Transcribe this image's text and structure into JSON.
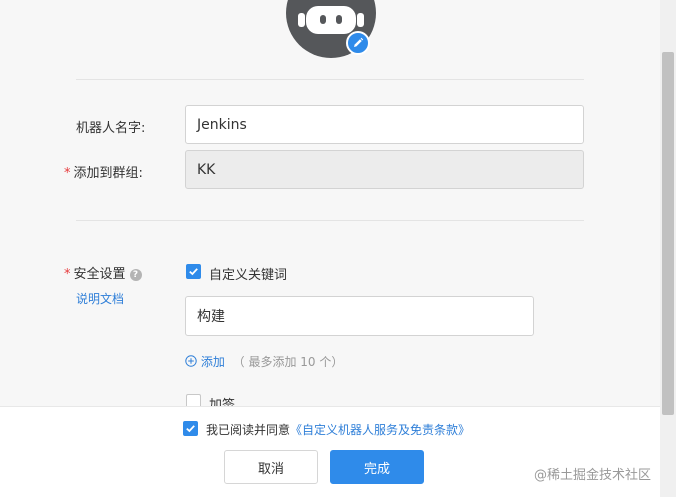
{
  "form": {
    "robot_name_label": "机器人名字:",
    "robot_name_value": "Jenkins",
    "group_label": "添加到群组:",
    "group_value": "KK",
    "required_mark": "*"
  },
  "security": {
    "label": "安全设置",
    "help_glyph": "?",
    "doc_link": "说明文档",
    "keyword_option_label": "自定义关键词",
    "keyword_option_checked": true,
    "keyword_value": "构建",
    "add_label": "添加",
    "add_hint": "（ 最多添加 10 个）",
    "sign_option_label": "加签",
    "sign_option_checked": false
  },
  "footer": {
    "agree_checked": true,
    "agree_prefix": "我已阅读并同意",
    "agree_link": "《自定义机器人服务及免责条款》",
    "cancel_label": "取消",
    "ok_label": "完成"
  },
  "watermark": "@稀土掘金技术社区",
  "colors": {
    "accent": "#2f8bea",
    "link": "#2f7fd8",
    "required": "#e6393b",
    "avatar_bg": "#55575a"
  }
}
